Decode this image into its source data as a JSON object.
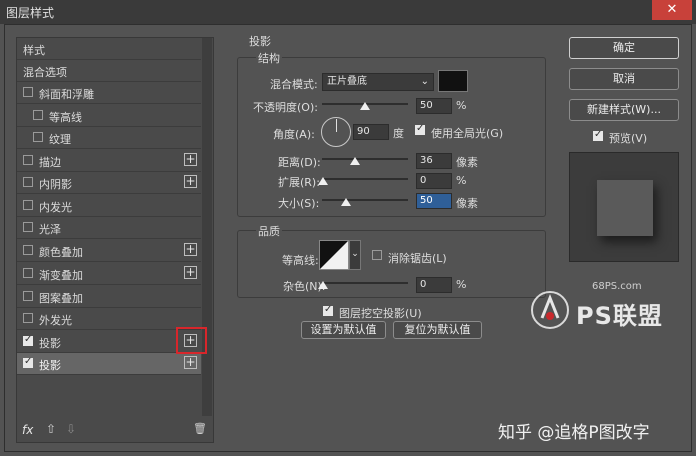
{
  "window": {
    "title": "图层样式",
    "close_glyph": "✕"
  },
  "sidebar": {
    "items": [
      {
        "label": "样式"
      },
      {
        "label": "混合选项"
      },
      {
        "label": "斜面和浮雕"
      },
      {
        "label": "等高线"
      },
      {
        "label": "纹理"
      },
      {
        "label": "描边"
      },
      {
        "label": "内阴影"
      },
      {
        "label": "内发光"
      },
      {
        "label": "光泽"
      },
      {
        "label": "颜色叠加"
      },
      {
        "label": "渐变叠加"
      },
      {
        "label": "图案叠加"
      },
      {
        "label": "外发光"
      },
      {
        "label": "投影"
      },
      {
        "label": "投影"
      }
    ],
    "plus_glyph": "+",
    "fx_label": "fx",
    "up_glyph": "⇧",
    "down_glyph": "⇩",
    "trash_glyph": "🗑"
  },
  "drop_shadow": {
    "section_title": "投影",
    "structure_title": "结构",
    "blend_mode_label": "混合模式:",
    "blend_mode_value": "正片叠底",
    "opacity_label": "不透明度(O):",
    "opacity_value": "50",
    "percent": "%",
    "opacity_level": 0.5,
    "angle_label": "角度(A):",
    "angle_value": "90",
    "degree_unit": "度",
    "global_light_label": "使用全局光(G)",
    "distance_label": "距离(D):",
    "distance_value": "36",
    "pixel_unit": "像素",
    "spread_label": "扩展(R):",
    "spread_value": "0",
    "size_label": "大小(S):",
    "size_value": "50",
    "quality_title": "品质",
    "contour_label": "等高线:",
    "antialias_label": "消除锯齿(L)",
    "noise_label": "杂色(N):",
    "noise_value": "0",
    "knockout_label": "图层挖空投影(U)",
    "set_default_button": "设置为默认值",
    "reset_default_button": "复位为默认值"
  },
  "buttons": {
    "ok": "确定",
    "cancel": "取消",
    "new_style": "新建样式(W)...",
    "preview": "预览(V)"
  },
  "watermark": {
    "site": "68PS.com",
    "brand": "PS联盟",
    "credit": "知乎 @追格P图改字"
  },
  "colors": {
    "accent_red": "#d8262b",
    "selected_field": "#2f5f98",
    "swatch": "#111111"
  }
}
